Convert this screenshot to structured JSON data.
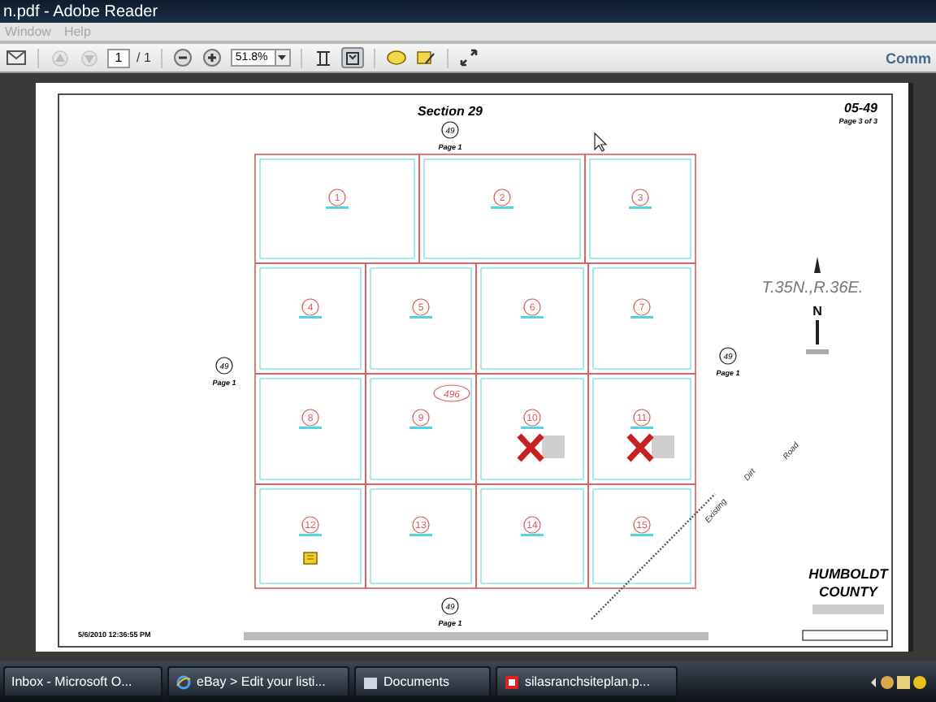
{
  "window": {
    "title": "n.pdf - Adobe Reader"
  },
  "menu": [
    "Window",
    "Help"
  ],
  "toolbar": {
    "nav_buttons": [
      {
        "kind": "previous",
        "disabled": true
      },
      {
        "kind": "next",
        "disabled": true
      }
    ],
    "page_number": "1",
    "page_count": "/ 1",
    "zoom": "51.8%",
    "view_buttons": [
      {
        "kind": "fit-width",
        "selected": false
      },
      {
        "kind": "fit-page",
        "selected": true
      }
    ],
    "right_label": "Comm"
  },
  "document": {
    "section_title": "Section 29",
    "sheet_number": "05-49",
    "page_of": "Page 3 of 3",
    "township": "T.35N.,R.36E.",
    "north_label": "N",
    "lot_label": "496",
    "references": [
      {
        "number": "49",
        "page": "Page 1"
      },
      {
        "number": "49",
        "page": "Page 1"
      },
      {
        "number": "49",
        "page": "Page 1"
      },
      {
        "number": "49",
        "page": "Page 1"
      }
    ],
    "parcels": [
      {
        "number": "1",
        "marked": false,
        "note": false
      },
      {
        "number": "2",
        "marked": false,
        "note": false
      },
      {
        "number": "3",
        "marked": false,
        "note": false
      },
      {
        "number": "4",
        "marked": false,
        "note": false
      },
      {
        "number": "5",
        "marked": false,
        "note": false
      },
      {
        "number": "6",
        "marked": false,
        "note": false
      },
      {
        "number": "7",
        "marked": false,
        "note": false
      },
      {
        "number": "8",
        "marked": false,
        "note": false
      },
      {
        "number": "9",
        "marked": false,
        "note": false
      },
      {
        "number": "10",
        "marked": true,
        "note": false
      },
      {
        "number": "11",
        "marked": true,
        "note": false
      },
      {
        "number": "12",
        "marked": false,
        "note": true
      },
      {
        "number": "13",
        "marked": false,
        "note": false
      },
      {
        "number": "14",
        "marked": false,
        "note": false
      },
      {
        "number": "15",
        "marked": false,
        "note": false
      }
    ],
    "road_label": [
      "Existing",
      "Dirt",
      "Road"
    ],
    "county": [
      "HUMBOLDT",
      "COUNTY"
    ],
    "timestamp": "5/6/2010 12:36:55 PM"
  },
  "taskbar": [
    {
      "label": "Inbox - Microsoft O...",
      "kind": "mail"
    },
    {
      "label": "eBay > Edit your listi...",
      "kind": "browser"
    },
    {
      "label": "Documents",
      "kind": "folder"
    },
    {
      "label": "silasranchsiteplan.p...",
      "kind": "pdf"
    }
  ]
}
